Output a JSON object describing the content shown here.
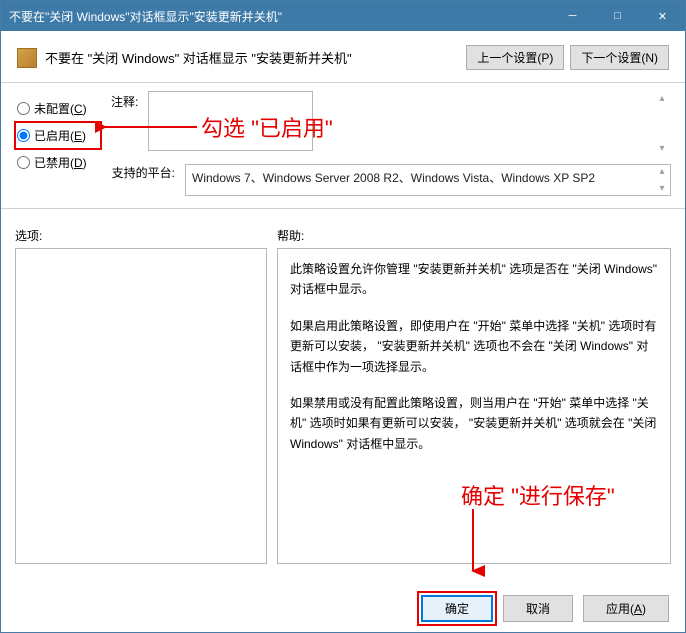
{
  "titlebar": {
    "text": "不要在\"关闭 Windows\"对话框显示\"安装更新并关机\""
  },
  "header": {
    "title": "不要在 \"关闭 Windows\" 对话框显示 \"安装更新并关机\"",
    "prev_btn": "上一个设置(P)",
    "next_btn": "下一个设置(N)"
  },
  "radios": {
    "not_configured": "未配置(C)",
    "enabled": "已启用(E)",
    "disabled": "已禁用(D)"
  },
  "comment": {
    "label": "注释:",
    "value": ""
  },
  "platform": {
    "label": "支持的平台:",
    "value": "Windows 7、Windows Server 2008 R2、Windows Vista、Windows XP SP2"
  },
  "sections": {
    "options": "选项:",
    "help": "帮助:"
  },
  "help": {
    "p1": "此策略设置允许你管理 \"安装更新并关机\" 选项是否在 \"关闭 Windows\" 对话框中显示。",
    "p2": "如果启用此策略设置，即使用户在 \"开始\" 菜单中选择 \"关机\" 选项时有更新可以安装， \"安装更新并关机\" 选项也不会在 \"关闭 Windows\" 对话框中作为一项选择显示。",
    "p3": "如果禁用或没有配置此策略设置，则当用户在 \"开始\" 菜单中选择 \"关机\" 选项时如果有更新可以安装， \"安装更新并关机\" 选项就会在 \"关闭 Windows\" 对话框中显示。"
  },
  "footer": {
    "ok": "确定",
    "cancel": "取消",
    "apply": "应用(A)"
  },
  "annotations": {
    "enable": "勾选 \"已启用\"",
    "save": "确定 \"进行保存\""
  }
}
